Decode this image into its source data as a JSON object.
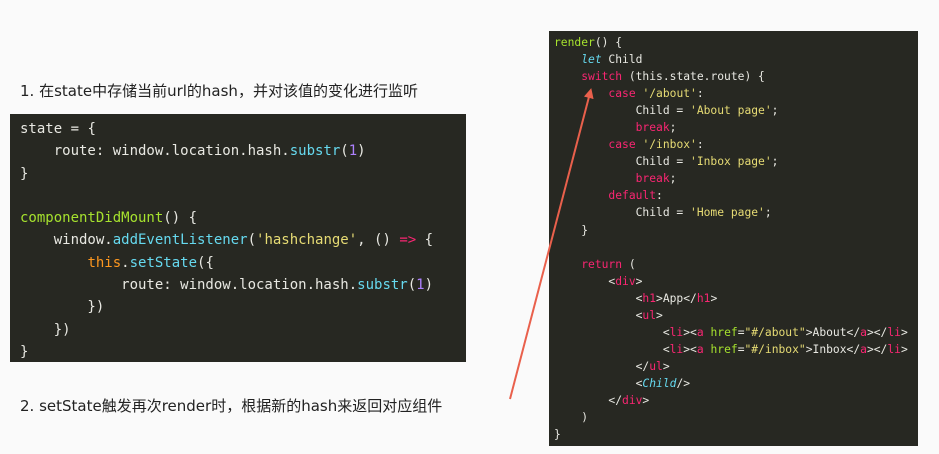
{
  "captions": {
    "step1": "1. 在state中存储当前url的hash，并对该值的变化进行监听",
    "step2": "2. setState触发再次render时，根据新的hash来返回对应组件"
  },
  "left_code": {
    "l1": [
      "state",
      " = {"
    ],
    "l2": [
      "    route: window.location.hash.",
      "substr",
      "(",
      "1",
      ")"
    ],
    "l3": [
      "}"
    ],
    "l4": [
      ""
    ],
    "l5": [
      "componentDidMount",
      "() {"
    ],
    "l6": [
      "    window.",
      "addEventListener",
      "(",
      "'hashchange'",
      ", () ",
      "=>",
      " {"
    ],
    "l7": [
      "        ",
      "this",
      ".",
      "setState",
      "({"
    ],
    "l8": [
      "            route: window.location.hash.",
      "substr",
      "(",
      "1",
      ")"
    ],
    "l9": [
      "        })"
    ],
    "l10": [
      "    })"
    ],
    "l11": [
      "}"
    ]
  },
  "right_code": {
    "r1": [
      "render",
      "() {"
    ],
    "r2": [
      "    ",
      "let",
      " Child"
    ],
    "r3": [
      "    ",
      "switch",
      " (this.state.route) {"
    ],
    "r4": [
      "        ",
      "case",
      " ",
      "'/about'",
      ":"
    ],
    "r5": [
      "            Child = ",
      "'About page'",
      ";"
    ],
    "r6": [
      "            ",
      "break",
      ";"
    ],
    "r7": [
      "        ",
      "case",
      " ",
      "'/inbox'",
      ":"
    ],
    "r8": [
      "            Child = ",
      "'Inbox page'",
      ";"
    ],
    "r9": [
      "            ",
      "break",
      ";"
    ],
    "r10": [
      "        ",
      "default",
      ":"
    ],
    "r11": [
      "            Child = ",
      "'Home page'",
      ";"
    ],
    "r12": [
      "    }"
    ],
    "r13": [
      ""
    ],
    "r14": [
      "    ",
      "return",
      " ("
    ],
    "r15": [
      "        <",
      "div",
      ">"
    ],
    "r16": [
      "            <",
      "h1",
      ">App</",
      "h1",
      ">"
    ],
    "r17": [
      "            <",
      "ul",
      ">"
    ],
    "r18": [
      "                <",
      "li",
      "><",
      "a",
      " ",
      "href",
      "=",
      "\"#/about\"",
      ">About</",
      "a",
      "></",
      "li",
      ">"
    ],
    "r19": [
      "                <",
      "li",
      "><",
      "a",
      " ",
      "href",
      "=",
      "\"#/inbox\"",
      ">Inbox</",
      "a",
      "></",
      "li",
      ">"
    ],
    "r20": [
      "            </",
      "ul",
      ">"
    ],
    "r21": [
      "            <",
      "Child",
      "/>"
    ],
    "r22": [
      "        </",
      "div",
      ">"
    ],
    "r23": [
      "    )"
    ],
    "r24": [
      "}"
    ]
  },
  "colors": {
    "code_bg": "#272822",
    "arrow": "#e9604c"
  }
}
